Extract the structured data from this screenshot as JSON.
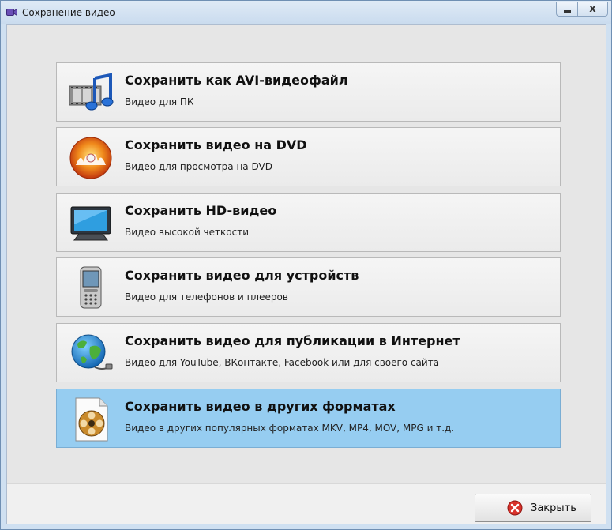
{
  "window": {
    "title": "Сохранение видео",
    "close_glyph": "x"
  },
  "options": [
    {
      "title": "Сохранить как AVI-видеофайл",
      "subtitle": "Видео для ПК",
      "icon": "film-music-icon",
      "selected": false
    },
    {
      "title": "Сохранить видео на DVD",
      "subtitle": "Видео для просмотра на DVD",
      "icon": "dvd-disc-icon",
      "selected": false
    },
    {
      "title": "Сохранить HD-видео",
      "subtitle": "Видео высокой четкости",
      "icon": "monitor-icon",
      "selected": false
    },
    {
      "title": "Сохранить видео для устройств",
      "subtitle": "Видео для телефонов и плееров",
      "icon": "phone-icon",
      "selected": false
    },
    {
      "title": "Сохранить видео для публикации в Интернет",
      "subtitle": "Видео для YouTube, ВКонтакте, Facebook или для своего сайта",
      "icon": "globe-icon",
      "selected": false
    },
    {
      "title": "Сохранить видео в других форматах",
      "subtitle": "Видео в других популярных форматах MKV, MP4, MOV, MPG и т.д.",
      "icon": "film-reel-file-icon",
      "selected": true
    }
  ],
  "footer": {
    "close_label": "Закрыть"
  },
  "colors": {
    "selected_bg": "#96cdf1",
    "close_icon_red": "#d9322b"
  }
}
